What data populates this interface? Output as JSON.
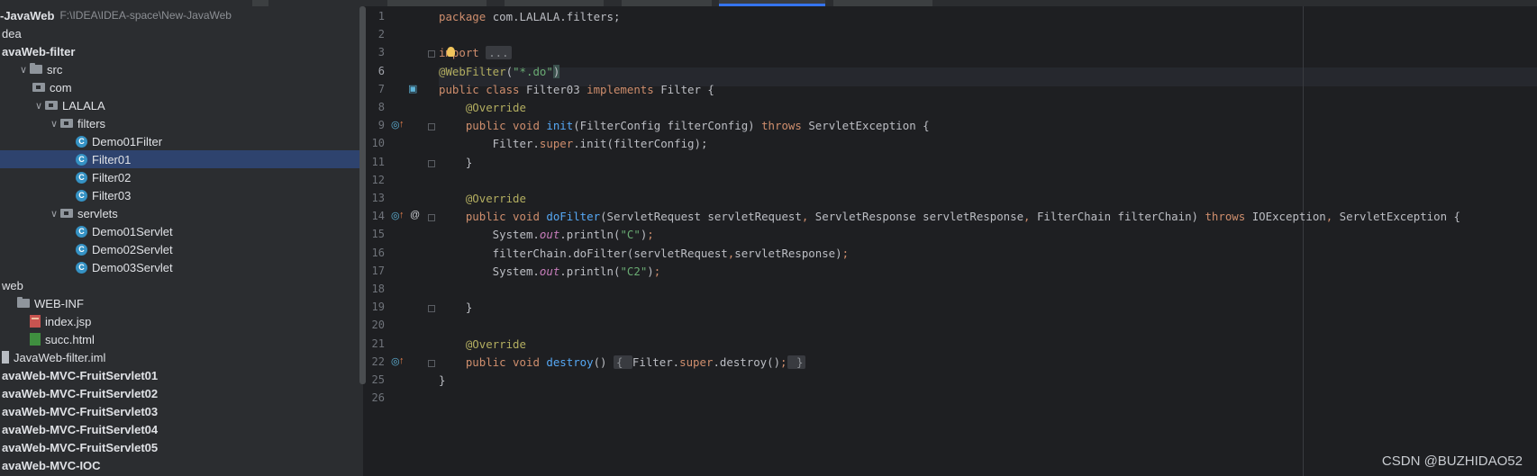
{
  "project_tree": {
    "root_name": "-JavaWeb",
    "root_path": "F:\\IDEA\\IDEA-space\\New-JavaWeb",
    "items": [
      {
        "label": "dea",
        "kind": "folder",
        "indent": 0
      },
      {
        "label": "avaWeb-filter",
        "kind": "module",
        "indent": 0,
        "bold": true
      },
      {
        "label": "src",
        "kind": "folder",
        "indent": 1
      },
      {
        "label": "com",
        "kind": "package",
        "indent": 2
      },
      {
        "label": "LALALA",
        "kind": "package",
        "indent": 2
      },
      {
        "label": "filters",
        "kind": "package",
        "indent": 3
      },
      {
        "label": "Demo01Filter",
        "kind": "class",
        "indent": 4
      },
      {
        "label": "Filter01",
        "kind": "class",
        "indent": 4,
        "selected": true
      },
      {
        "label": "Filter02",
        "kind": "class",
        "indent": 4
      },
      {
        "label": "Filter03",
        "kind": "class",
        "indent": 4
      },
      {
        "label": "servlets",
        "kind": "package",
        "indent": 3
      },
      {
        "label": "Demo01Servlet",
        "kind": "class",
        "indent": 4
      },
      {
        "label": "Demo02Servlet",
        "kind": "class",
        "indent": 4
      },
      {
        "label": "Demo03Servlet",
        "kind": "class",
        "indent": 4
      },
      {
        "label": "web",
        "kind": "folder",
        "indent": 0
      },
      {
        "label": "WEB-INF",
        "kind": "folder",
        "indent": 1
      },
      {
        "label": "index.jsp",
        "kind": "jsp",
        "indent": 1
      },
      {
        "label": "succ.html",
        "kind": "html",
        "indent": 1
      },
      {
        "label": "JavaWeb-filter.iml",
        "kind": "iml",
        "indent": 0
      },
      {
        "label": "avaWeb-MVC-FruitServlet01",
        "kind": "module",
        "indent": 0,
        "bold": true
      },
      {
        "label": "avaWeb-MVC-FruitServlet02",
        "kind": "module",
        "indent": 0,
        "bold": true
      },
      {
        "label": "avaWeb-MVC-FruitServlet03",
        "kind": "module",
        "indent": 0,
        "bold": true
      },
      {
        "label": "avaWeb-MVC-FruitServlet04",
        "kind": "module",
        "indent": 0,
        "bold": true
      },
      {
        "label": "avaWeb-MVC-FruitServlet05",
        "kind": "module",
        "indent": 0,
        "bold": true
      },
      {
        "label": "avaWeb-MVC-IOC",
        "kind": "module",
        "indent": 0,
        "bold": true
      }
    ]
  },
  "editor": {
    "current_line": "6",
    "lines": [
      {
        "n": "1",
        "tokens": [
          [
            "kw",
            "package "
          ],
          [
            "",
            "com.LALALA.filters;"
          ]
        ]
      },
      {
        "n": "2",
        "tokens": []
      },
      {
        "n": "3",
        "tokens": [
          [
            "kw",
            "import "
          ],
          [
            "fold-box",
            "..."
          ]
        ]
      },
      {
        "n": "6",
        "tokens": [
          [
            "ann",
            "@WebFilter"
          ],
          [
            "",
            "("
          ],
          [
            "str",
            "\"*.do\""
          ],
          [
            "caret-hl",
            ")"
          ]
        ]
      },
      {
        "n": "7",
        "tokens": [
          [
            "kw",
            "public class "
          ],
          [
            "",
            "Filter03 "
          ],
          [
            "kw",
            "implements "
          ],
          [
            "",
            "Filter {"
          ]
        ]
      },
      {
        "n": "8",
        "tokens": [
          [
            "",
            "    "
          ],
          [
            "ann",
            "@Override"
          ]
        ]
      },
      {
        "n": "9",
        "tokens": [
          [
            "",
            "    "
          ],
          [
            "kw",
            "public void "
          ],
          [
            "fn",
            "init"
          ],
          [
            "",
            "(FilterConfig filterConfig) "
          ],
          [
            "kw",
            "throws "
          ],
          [
            "",
            "ServletException {"
          ]
        ]
      },
      {
        "n": "10",
        "tokens": [
          [
            "",
            "        Filter."
          ],
          [
            "kw",
            "super"
          ],
          [
            "",
            ".init(filterConfig);"
          ]
        ]
      },
      {
        "n": "11",
        "tokens": [
          [
            "",
            "    }"
          ]
        ]
      },
      {
        "n": "12",
        "tokens": []
      },
      {
        "n": "13",
        "tokens": [
          [
            "",
            "    "
          ],
          [
            "ann",
            "@Override"
          ]
        ]
      },
      {
        "n": "14",
        "tokens": [
          [
            "",
            "    "
          ],
          [
            "kw",
            "public void "
          ],
          [
            "fn",
            "doFilter"
          ],
          [
            "",
            "(ServletRequest servletRequest"
          ],
          [
            "kw",
            ", "
          ],
          [
            "",
            "ServletResponse servletResponse"
          ],
          [
            "kw",
            ", "
          ],
          [
            "",
            "FilterChain filterChain) "
          ],
          [
            "kw",
            "throws "
          ],
          [
            "",
            "IOException"
          ],
          [
            "kw",
            ", "
          ],
          [
            "",
            "ServletException {"
          ]
        ]
      },
      {
        "n": "15",
        "tokens": [
          [
            "",
            "        System."
          ],
          [
            "ital",
            "out"
          ],
          [
            "",
            ".println("
          ],
          [
            "str",
            "\"C\""
          ],
          [
            "",
            ")"
          ],
          [
            "kw",
            ";"
          ]
        ]
      },
      {
        "n": "16",
        "tokens": [
          [
            "",
            "        filterChain.doFilter(servletRequest"
          ],
          [
            "kw",
            ","
          ],
          [
            "",
            "servletResponse)"
          ],
          [
            "kw",
            ";"
          ]
        ]
      },
      {
        "n": "17",
        "tokens": [
          [
            "",
            "        System."
          ],
          [
            "ital",
            "out"
          ],
          [
            "",
            ".println("
          ],
          [
            "str",
            "\"C2\""
          ],
          [
            "",
            ")"
          ],
          [
            "kw",
            ";"
          ]
        ]
      },
      {
        "n": "18",
        "tokens": []
      },
      {
        "n": "19",
        "tokens": [
          [
            "",
            "    }"
          ]
        ]
      },
      {
        "n": "20",
        "tokens": []
      },
      {
        "n": "21",
        "tokens": [
          [
            "",
            "    "
          ],
          [
            "ann",
            "@Override"
          ]
        ]
      },
      {
        "n": "22",
        "tokens": [
          [
            "",
            "    "
          ],
          [
            "kw",
            "public void "
          ],
          [
            "fn",
            "destroy"
          ],
          [
            "",
            "() "
          ],
          [
            "fold-box",
            "{ "
          ],
          [
            "",
            "Filter."
          ],
          [
            "kw",
            "super"
          ],
          [
            "",
            ".destroy()"
          ],
          [
            "kw",
            ";"
          ],
          [
            "fold-box",
            " }"
          ]
        ]
      },
      {
        "n": "25",
        "tokens": [
          [
            "",
            "}"
          ]
        ]
      },
      {
        "n": "26",
        "tokens": []
      }
    ]
  },
  "gutter_icons": {
    "7": [
      "class-gutter-icon"
    ],
    "9": [
      "override-icon",
      "implement-icon"
    ],
    "14": [
      "override-icon",
      "implement-icon",
      "at-icon"
    ],
    "22": [
      "override-icon",
      "implement-icon"
    ]
  },
  "watermark": "CSDN @BUZHIDAO52"
}
